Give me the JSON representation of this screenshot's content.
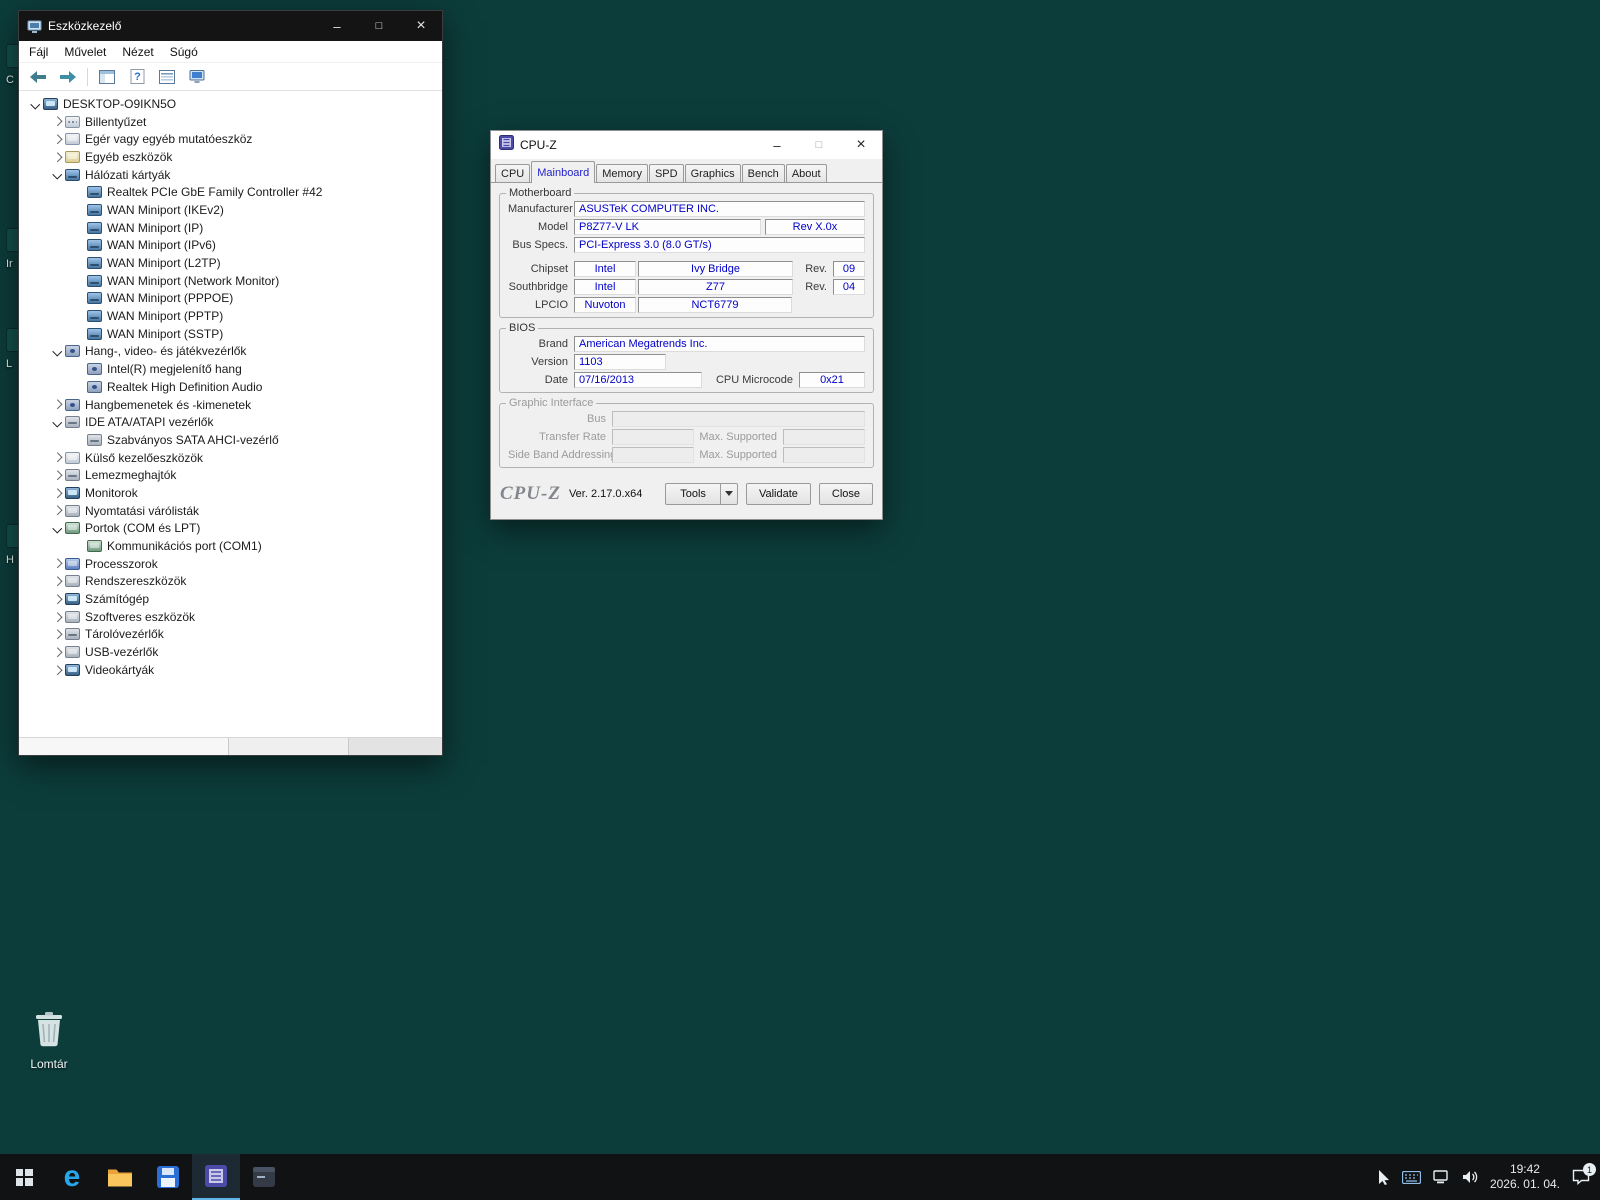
{
  "desktop": {
    "recycle_bin_label": "Lomtár",
    "partial_icon_labels": [
      "C",
      "Ir",
      "L",
      "H"
    ]
  },
  "device_manager": {
    "title": "Eszközkezelő",
    "menus": [
      "Fájl",
      "Művelet",
      "Nézet",
      "Súgó"
    ],
    "tree": [
      {
        "label": "DESKTOP-O9IKN5O",
        "level": 0,
        "state": "expanded",
        "icon": "computer"
      },
      {
        "label": "Billentyűzet",
        "level": 1,
        "state": "collapsed",
        "icon": "keyboard"
      },
      {
        "label": "Egér vagy egyéb mutatóeszköz",
        "level": 1,
        "state": "collapsed",
        "icon": "mouse"
      },
      {
        "label": "Egyéb eszközök",
        "level": 1,
        "state": "collapsed",
        "icon": "unknown"
      },
      {
        "label": "Hálózati kártyák",
        "level": 1,
        "state": "expanded",
        "icon": "network"
      },
      {
        "label": "Realtek PCIe GbE Family Controller #42",
        "level": 2,
        "state": "leaf",
        "icon": "network"
      },
      {
        "label": "WAN Miniport (IKEv2)",
        "level": 2,
        "state": "leaf",
        "icon": "network"
      },
      {
        "label": "WAN Miniport (IP)",
        "level": 2,
        "state": "leaf",
        "icon": "network"
      },
      {
        "label": "WAN Miniport (IPv6)",
        "level": 2,
        "state": "leaf",
        "icon": "network"
      },
      {
        "label": "WAN Miniport (L2TP)",
        "level": 2,
        "state": "leaf",
        "icon": "network"
      },
      {
        "label": "WAN Miniport (Network Monitor)",
        "level": 2,
        "state": "leaf",
        "icon": "network"
      },
      {
        "label": "WAN Miniport (PPPOE)",
        "level": 2,
        "state": "leaf",
        "icon": "network"
      },
      {
        "label": "WAN Miniport (PPTP)",
        "level": 2,
        "state": "leaf",
        "icon": "network"
      },
      {
        "label": "WAN Miniport (SSTP)",
        "level": 2,
        "state": "leaf",
        "icon": "network"
      },
      {
        "label": "Hang-, video- és játékvezérlők",
        "level": 1,
        "state": "expanded",
        "icon": "audio"
      },
      {
        "label": "Intel(R) megjelenítő hang",
        "level": 2,
        "state": "leaf",
        "icon": "audio"
      },
      {
        "label": "Realtek High Definition Audio",
        "level": 2,
        "state": "leaf",
        "icon": "audio"
      },
      {
        "label": "Hangbemenetek és -kimenetek",
        "level": 1,
        "state": "collapsed",
        "icon": "speaker"
      },
      {
        "label": "IDE ATA/ATAPI vezérlők",
        "level": 1,
        "state": "expanded",
        "icon": "ide"
      },
      {
        "label": "Szabványos SATA AHCI-vezérlő",
        "level": 2,
        "state": "leaf",
        "icon": "ide"
      },
      {
        "label": "Külső kezelőeszközök",
        "level": 1,
        "state": "collapsed",
        "icon": "hid"
      },
      {
        "label": "Lemezmeghajtók",
        "level": 1,
        "state": "collapsed",
        "icon": "disk"
      },
      {
        "label": "Monitorok",
        "level": 1,
        "state": "collapsed",
        "icon": "monitor"
      },
      {
        "label": "Nyomtatási várólisták",
        "level": 1,
        "state": "collapsed",
        "icon": "printer"
      },
      {
        "label": "Portok (COM és LPT)",
        "level": 1,
        "state": "expanded",
        "icon": "ports"
      },
      {
        "label": "Kommunikációs port (COM1)",
        "level": 2,
        "state": "leaf",
        "icon": "ports"
      },
      {
        "label": "Processzorok",
        "level": 1,
        "state": "collapsed",
        "icon": "cpu"
      },
      {
        "label": "Rendszereszközök",
        "level": 1,
        "state": "collapsed",
        "icon": "system"
      },
      {
        "label": "Számítógép",
        "level": 1,
        "state": "collapsed",
        "icon": "computer"
      },
      {
        "label": "Szoftveres eszközök",
        "level": 1,
        "state": "collapsed",
        "icon": "software"
      },
      {
        "label": "Tárolóvezérlők",
        "level": 1,
        "state": "collapsed",
        "icon": "storage"
      },
      {
        "label": "USB-vezérlők",
        "level": 1,
        "state": "collapsed",
        "icon": "usb"
      },
      {
        "label": "Videokártyák",
        "level": 1,
        "state": "collapsed",
        "icon": "gpu"
      }
    ]
  },
  "cpuz": {
    "title": "CPU-Z",
    "tabs": [
      "CPU",
      "Mainboard",
      "Memory",
      "SPD",
      "Graphics",
      "Bench",
      "About"
    ],
    "active_tab": "Mainboard",
    "motherboard": {
      "group_label": "Motherboard",
      "manufacturer_label": "Manufacturer",
      "manufacturer": "ASUSTeK COMPUTER INC.",
      "model_label": "Model",
      "model": "P8Z77-V LK",
      "model_rev": "Rev X.0x",
      "bus_specs_label": "Bus Specs.",
      "bus_specs": "PCI-Express 3.0 (8.0 GT/s)",
      "chipset_label": "Chipset",
      "chipset_vendor": "Intel",
      "chipset": "Ivy Bridge",
      "chipset_rev_label": "Rev.",
      "chipset_rev": "09",
      "southbridge_label": "Southbridge",
      "southbridge_vendor": "Intel",
      "southbridge": "Z77",
      "southbridge_rev_label": "Rev.",
      "southbridge_rev": "04",
      "lpcio_label": "LPCIO",
      "lpcio_vendor": "Nuvoton",
      "lpcio": "NCT6779"
    },
    "bios": {
      "group_label": "BIOS",
      "brand_label": "Brand",
      "brand": "American Megatrends Inc.",
      "version_label": "Version",
      "version": "1103",
      "date_label": "Date",
      "date": "07/16/2013",
      "microcode_label": "CPU Microcode",
      "microcode": "0x21"
    },
    "graphic_interface": {
      "group_label": "Graphic Interface",
      "bus_label": "Bus",
      "transfer_rate_label": "Transfer Rate",
      "max_supported_label": "Max. Supported",
      "side_band_label": "Side Band Addressing",
      "max_supported2_label": "Max. Supported"
    },
    "footer": {
      "logo": "CPU-Z",
      "version": "Ver. 2.17.0.x64",
      "tools_button": "Tools",
      "validate_button": "Validate",
      "close_button": "Close"
    }
  },
  "taskbar": {
    "time": "19:42",
    "date": "2026. 01. 04.",
    "notification_badge": "1"
  }
}
